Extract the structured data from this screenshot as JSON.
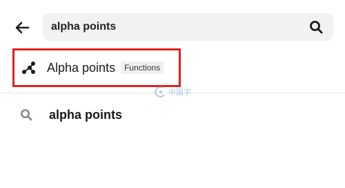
{
  "header": {
    "back_icon": "arrow-left-icon",
    "search": {
      "value": "alpha points",
      "placeholder": ""
    },
    "search_icon": "search-icon"
  },
  "suggestion": {
    "icon": "scatter-points-icon",
    "title": "Alpha points",
    "badge": "Functions"
  },
  "query": {
    "icon": "search-icon",
    "text": "alpha points"
  },
  "colors": {
    "highlight_border": "#e02020",
    "search_background": "#f2f2f2",
    "badge_background": "#f0f0f0"
  }
}
